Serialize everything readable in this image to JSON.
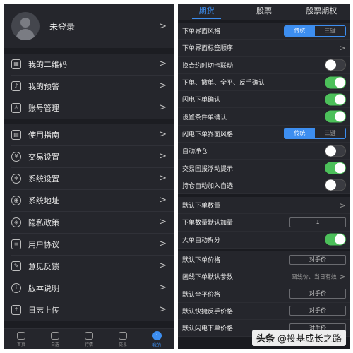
{
  "left_panel": {
    "profile": {
      "name": "未登录"
    },
    "group1": [
      {
        "label": "我的二维码",
        "icon": "qrcode-icon"
      },
      {
        "label": "我的预警",
        "icon": "bell-icon"
      },
      {
        "label": "账号管理",
        "icon": "user-icon"
      }
    ],
    "group2": [
      {
        "label": "使用指南",
        "icon": "book-icon"
      },
      {
        "label": "交易设置",
        "icon": "yen-icon"
      },
      {
        "label": "系统设置",
        "icon": "gear-icon"
      },
      {
        "label": "系统地址",
        "icon": "location-icon"
      },
      {
        "label": "隐私政策",
        "icon": "shield-icon"
      },
      {
        "label": "用户协议",
        "icon": "document-icon"
      },
      {
        "label": "意见反馈",
        "icon": "feedback-icon"
      },
      {
        "label": "版本说明",
        "icon": "info-icon"
      },
      {
        "label": "日志上传",
        "icon": "upload-icon"
      }
    ],
    "tabbar": [
      {
        "label": "首页",
        "icon": "home-icon"
      },
      {
        "label": "自选",
        "icon": "star-icon"
      },
      {
        "label": "行情",
        "icon": "chart-icon"
      },
      {
        "label": "交易",
        "icon": "trade-icon"
      },
      {
        "label": "我的",
        "icon": "profile-icon",
        "active": true
      }
    ]
  },
  "right_panel": {
    "tabs": [
      "期货",
      "股票",
      "股票期权"
    ],
    "active_tab": 0,
    "segment": {
      "a": "传统",
      "b": "三键"
    },
    "group1": [
      {
        "label": "下单界面风格",
        "type": "segment"
      },
      {
        "label": "下单界面标签顺序",
        "type": "chevron"
      },
      {
        "label": "换合约时切卡联动",
        "type": "toggle",
        "on": false
      },
      {
        "label": "下单、撤单、全平、反手确认",
        "type": "toggle",
        "on": true
      },
      {
        "label": "闪电下单确认",
        "type": "toggle",
        "on": true
      },
      {
        "label": "设置条件单确认",
        "type": "toggle",
        "on": true
      },
      {
        "label": "闪电下单界面风格",
        "type": "segment"
      },
      {
        "label": "自动净仓",
        "type": "toggle",
        "on": false
      },
      {
        "label": "交易回报浮动提示",
        "type": "toggle",
        "on": true
      },
      {
        "label": "持仓自动加入自选",
        "type": "toggle",
        "on": false
      }
    ],
    "group2": [
      {
        "label": "默认下单数量",
        "type": "chevron"
      },
      {
        "label": "下单数量默认加量",
        "type": "value",
        "value": "1"
      },
      {
        "label": "大单自动拆分",
        "type": "toggle",
        "on": true
      }
    ],
    "group3": [
      {
        "label": "默认下单价格",
        "type": "value",
        "value": "对手价"
      },
      {
        "label": "画线下单默认参数",
        "type": "text-chevron",
        "value": "画线价、当日有效"
      },
      {
        "label": "默认全平价格",
        "type": "value",
        "value": "对手价"
      },
      {
        "label": "默认快捷反手价格",
        "type": "value",
        "value": "对手价"
      },
      {
        "label": "默认闪电下单价格",
        "type": "value",
        "value": "对手价"
      }
    ]
  },
  "watermark": {
    "brand": "头条",
    "text": "@投基成长之路"
  },
  "colors": {
    "accent": "#3d8ef0",
    "toggle_on": "#4cc05a",
    "bg": "#1c1d22"
  }
}
